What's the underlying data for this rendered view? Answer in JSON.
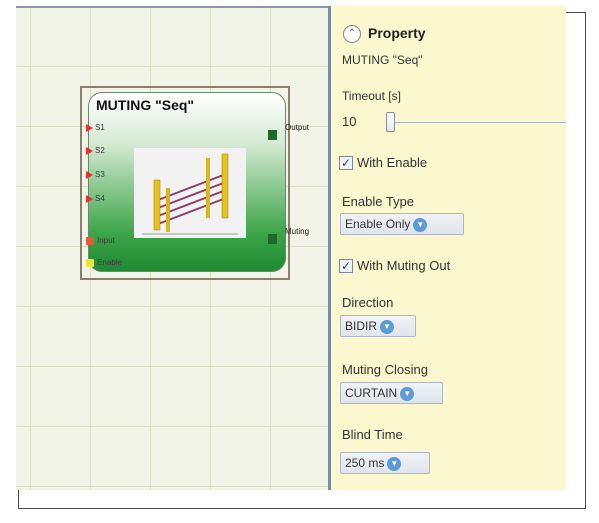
{
  "block": {
    "title": "MUTING \"Seq\"",
    "inputs": [
      "S1",
      "S2",
      "S3",
      "S4"
    ],
    "input_label": "Input",
    "enable_label": "Enable",
    "outputs": [
      "Output",
      "Muting"
    ]
  },
  "property": {
    "header": "Property",
    "name": "MUTING \"Seq\"",
    "timeout_label": "Timeout [s]",
    "timeout_value": "10",
    "with_enable": {
      "label": "With Enable",
      "checked": true
    },
    "enable_type": {
      "label": "Enable Type",
      "value": "Enable Only"
    },
    "with_muting_out": {
      "label": "With Muting Out",
      "checked": true
    },
    "direction": {
      "label": "Direction",
      "value": "BIDIR"
    },
    "muting_closing": {
      "label": "Muting Closing",
      "value": "CURTAIN"
    },
    "blind_time": {
      "label": "Blind Time",
      "value": "250 ms"
    }
  },
  "colors": {
    "panel_bg": "#fbf7cf",
    "canvas_bg": "#f1f4e6",
    "block_green": "#3ea64a",
    "pin_red": "#e23030",
    "pin_yellow": "#f2e13a",
    "dropdown_blue": "#5b9bd6"
  },
  "icons": {
    "collapse": "chevron-up-icon",
    "dropdown": "chevron-down-icon",
    "check": "check-icon"
  }
}
